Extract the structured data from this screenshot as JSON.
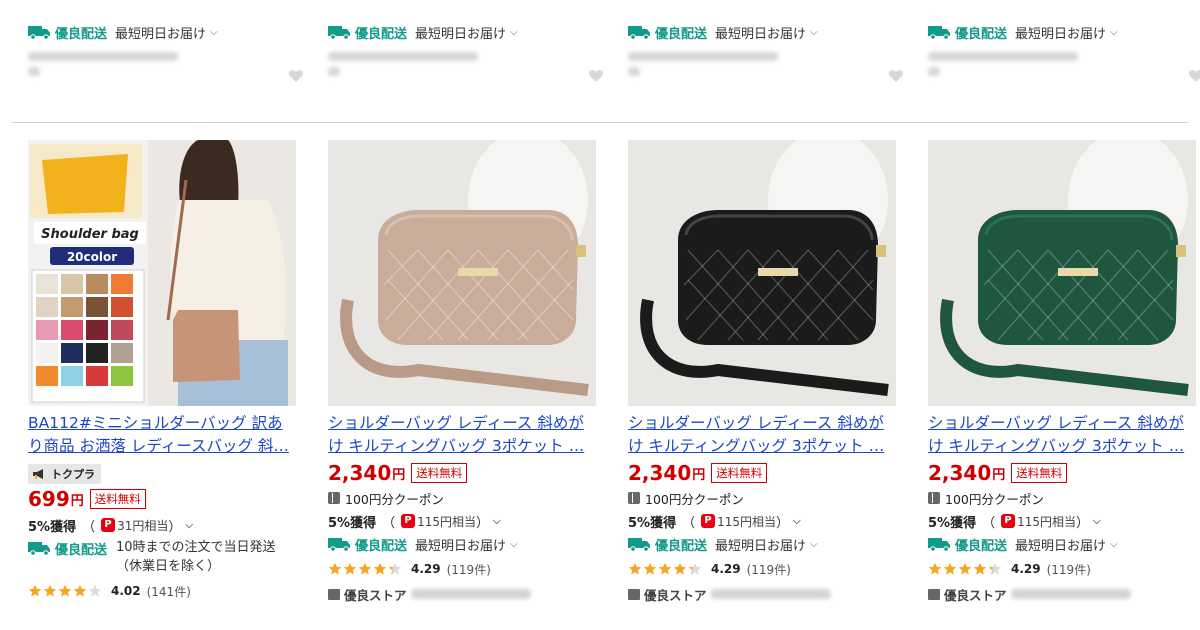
{
  "top_row": {
    "items": [
      {
        "shipping_tag": "優良配送",
        "shipping_text": "最短明日お届け"
      },
      {
        "shipping_tag": "優良配送",
        "shipping_text": "最短明日お届け"
      },
      {
        "shipping_tag": "優良配送",
        "shipping_text": "最短明日お届け"
      },
      {
        "shipping_tag": "優良配送",
        "shipping_text": "最短明日お届け"
      }
    ]
  },
  "products": [
    {
      "image_caption": "Shoulder bag",
      "image_badge": "20color",
      "title": "BA112#ミニショルダーバッグ 訳あり商品 お洒落 レディースバッグ 斜…",
      "promo_badge": "トクプラ",
      "price": "699",
      "yen": "円",
      "free_shipping": "送料無料",
      "points_label": "5%獲得",
      "points_value": "31円相当",
      "shipping_tag": "優良配送",
      "shipping_note": "10時までの注文で当日発送（休業日を除く）",
      "rating": "4.02",
      "review_count": "(141件)",
      "rating_fill": 4.0
    },
    {
      "title": "ショルダーバッグ レディース 斜めがけ キルティングバッグ 3ポケット …",
      "price": "2,340",
      "yen": "円",
      "free_shipping": "送料無料",
      "coupon": "100円分クーポン",
      "points_label": "5%獲得",
      "points_value": "115円相当",
      "shipping_tag": "優良配送",
      "shipping_text": "最短明日お届け",
      "rating": "4.29",
      "review_count": "(119件)",
      "rating_fill": 4.29,
      "store_label": "優良ストア",
      "bag_color": "#c9ad9a"
    },
    {
      "title": "ショルダーバッグ レディース 斜めがけ キルティングバッグ 3ポケット …",
      "price": "2,340",
      "yen": "円",
      "free_shipping": "送料無料",
      "coupon": "100円分クーポン",
      "points_label": "5%獲得",
      "points_value": "115円相当",
      "shipping_tag": "優良配送",
      "shipping_text": "最短明日お届け",
      "rating": "4.29",
      "review_count": "(119件)",
      "rating_fill": 4.29,
      "store_label": "優良ストア",
      "bag_color": "#1b1b1b"
    },
    {
      "title": "ショルダーバッグ レディース 斜めがけ キルティングバッグ 3ポケット …",
      "price": "2,340",
      "yen": "円",
      "free_shipping": "送料無料",
      "coupon": "100円分クーポン",
      "points_label": "5%獲得",
      "points_value": "115円相当",
      "shipping_tag": "優良配送",
      "shipping_text": "最短明日お届け",
      "rating": "4.29",
      "review_count": "(119件)",
      "rating_fill": 4.29,
      "store_label": "優良ストア",
      "bag_color": "#1f5640"
    }
  ],
  "colors": {
    "link": "#1a47c8",
    "price": "#d10000",
    "shipping": "#129a8a",
    "star": "#f5a623"
  }
}
